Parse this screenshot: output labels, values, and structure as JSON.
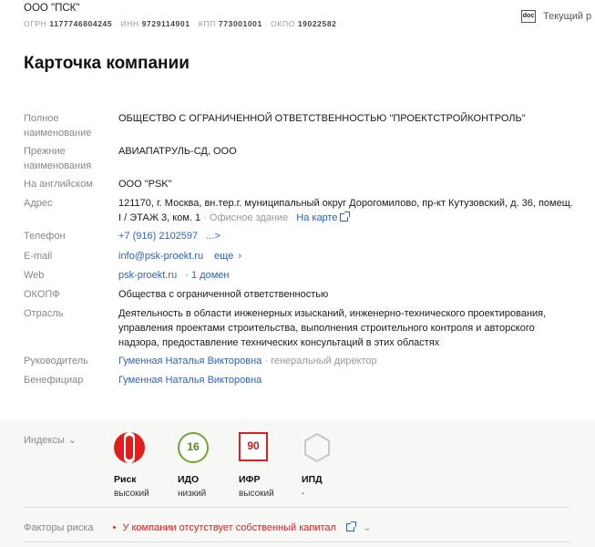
{
  "header": {
    "company_short": "ООО \"ПСК\"",
    "ogrn_label": "ОГРН",
    "ogrn": "1177746804245",
    "inn_label": "ИНН",
    "inn": "9729114901",
    "kpp_label": "КПП",
    "kpp": "773001001",
    "okpo_label": "ОКПО",
    "okpo": "19022582",
    "doc_icon_text": "doc",
    "doc_label": "Текущий р"
  },
  "title": "Карточка компании",
  "card": {
    "full_name_label": "Полное наименование",
    "full_name": "ОБЩЕСТВО С ОГРАНИЧЕННОЙ ОТВЕТСТВЕННОСТЬЮ \"ПРОЕКТСТРОЙКОНТРОЛЬ\"",
    "prev_names_label": "Прежние наименования",
    "prev_names": "АВИАПАТРУЛЬ-СД, ООО",
    "english_label": "На английском",
    "english": "ООО \"PSK\"",
    "address_label": "Адрес",
    "address": "121170, г. Москва, вн.тер.г. муниципальный округ Дорогомилово, пр-кт Кутузовский, д. 36, помещ. I / ЭТАЖ 3, ком. 1",
    "address_type": "· Офисное здание",
    "map_link": "На карте",
    "phone_label": "Телефон",
    "phone": "+7 (916) 2102597",
    "phone_more": "...>",
    "email_label": "E-mail",
    "email": "info@psk-proekt.ru",
    "email_more": "еще",
    "web_label": "Web",
    "web": "psk-proekt.ru",
    "web_domains": "· 1 домен",
    "okopf_label": "ОКОПФ",
    "okopf": "Общества с ограниченной ответственностью",
    "industry_label": "Отрасль",
    "industry": "Деятельность в области инженерных изысканий, инженерно-технического проектирования, управления проектами строительства, выполнения строительного контроля и авторского надзора, предоставление технических консультаций в этих областях",
    "head_label": "Руководитель",
    "head": "Гуменная Наталья Викторовна",
    "head_role": "· генеральный директор",
    "beneficiary_label": "Бенефициар",
    "beneficiary": "Гуменная Наталья Викторовна"
  },
  "indices": {
    "label": "Индексы",
    "items": [
      {
        "name": "Риск",
        "level": "высокий",
        "icon": "risk-icon"
      },
      {
        "name": "ИДО",
        "value": "16",
        "level": "низкий"
      },
      {
        "name": "ИФР",
        "value": "90",
        "level": "высокий"
      },
      {
        "name": "ИПД",
        "level": "-",
        "icon": "hexagon-icon"
      }
    ]
  },
  "factors": {
    "label": "Факторы риска",
    "bullet": "•",
    "item": "У компании отсутствует собственный капитал"
  },
  "colors": {
    "accent_link": "#2a63c2",
    "danger": "#e01e1e",
    "good": "#6fa533",
    "muted": "#888888"
  }
}
